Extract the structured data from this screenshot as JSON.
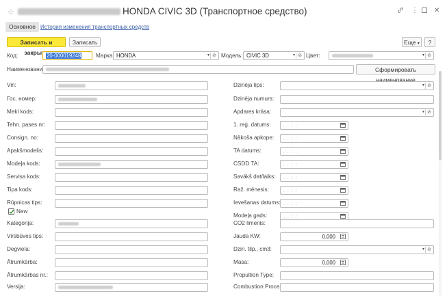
{
  "window": {
    "title": "HONDA CIVIC 3D (Транспортное средство)",
    "title_prefix_redacted": true
  },
  "tabs": [
    {
      "label": "Основное",
      "active": true
    },
    {
      "label": "История изменения транспортных средств",
      "active": false
    }
  ],
  "toolbar": {
    "save_close_label": "Записать и закрыть",
    "save_label": "Записать",
    "more_label": "Еще",
    "help_label": "?"
  },
  "header": {
    "code_label": "Код:",
    "code_value": "20-000019248",
    "brand_label": "Марка:",
    "brand_value": "HONDA",
    "model_label": "Модель:",
    "model_value": "CIVIC 3D",
    "color_label": "Цвет:",
    "name_label": "Наименование:",
    "generate_name_label": "Сформировать наименование"
  },
  "left_fields": [
    {
      "label": "Vin:",
      "value": "",
      "redacted": true
    },
    {
      "label": "Гос. номер:",
      "value": "",
      "redacted": true
    },
    {
      "label": "Mekl kods:",
      "value": ""
    },
    {
      "label": "Tehn. pases nr:",
      "value": ""
    },
    {
      "label": "Consign. no:",
      "value": ""
    },
    {
      "label": "Apakšmodelis:",
      "value": ""
    },
    {
      "label": "Modeļa kods:",
      "value": "",
      "redacted": true
    },
    {
      "label": "Servisa kods:",
      "value": ""
    },
    {
      "label": "Tipa kods:",
      "value": ""
    },
    {
      "label": "Rūpnicas tips:",
      "value": ""
    }
  ],
  "new_checkbox": {
    "label": "New",
    "checked": true
  },
  "left_fields2": [
    {
      "label": "Kategorija:",
      "value": "",
      "redacted": true
    },
    {
      "label": "Virsbūves tips:",
      "value": ""
    },
    {
      "label": "Degviela:",
      "value": ""
    },
    {
      "label": "Ātrumkārba:",
      "value": ""
    },
    {
      "label": "Ātrumkārbas nr.:",
      "value": ""
    },
    {
      "label": "Versija:",
      "value": "",
      "redacted": true
    }
  ],
  "right_fields": {
    "dzinejs_tips": "Dzinēja tips:",
    "dzinejs_numurs": "Dzinēja numurs:",
    "apdares_krasa": "Apdares krāsa:",
    "reg_datums": "1. reģ. datums:",
    "nakosa_apkope": "Nākoša apkope:",
    "ta_datums": "TA datums:",
    "csdd_ta": "CSDD TA:",
    "savaks_dat": "Savākš dat/laiks:",
    "raz_menesis": "Raž. mēnesis:",
    "ievesanas": "Ievešanas datums:",
    "modela_gads": "Modeļa gads:",
    "co2": "CO2 limenis:",
    "jauda_label": "Jauda KW:",
    "jauda_value": "0,000",
    "dzin_tilp": "Dzin. tilp., cm3:",
    "masa_label": "Masa:",
    "masa_value": "0,000",
    "propultion": "Propultion Type:",
    "combustion": "Combustion Process:"
  },
  "date_mask": ". .   : :"
}
